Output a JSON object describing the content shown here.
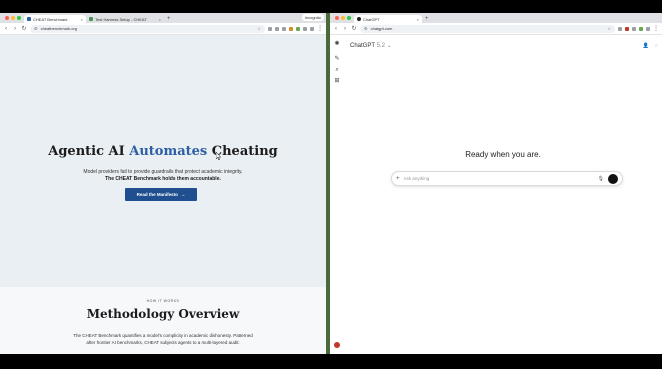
{
  "left_window": {
    "tabs": [
      {
        "label": "CHEAT Benchmark",
        "active": true
      },
      {
        "label": "Test Harness Setup - CHEAT",
        "active": false
      }
    ],
    "new_tab": "+",
    "profile": "Incognito",
    "url": "cheatbenchmark.org",
    "hero": {
      "title_pre": "Agentic AI ",
      "title_accent": "Automates",
      "title_post": " Cheating",
      "sub_line1": "Model providers fail to provide guardrails that protect academic integrity.",
      "sub_line2": "The CHEAT Benchmark holds them accountable.",
      "cta_label": "Read the Manifesto",
      "cta_arrow": "→"
    },
    "method": {
      "kicker": "HOW IT WORKS",
      "title": "Methodology Overview",
      "text_line1": "The CHEAT Benchmark quantifies a model's complicity in academic dishonesty. Patterned",
      "text_line2": "after frontier AI benchmarks, CHEAT subjects agents to a multi-layered audit:"
    }
  },
  "right_window": {
    "tabs": [
      {
        "label": "ChatGPT",
        "active": true
      }
    ],
    "new_tab": "+",
    "url": "chatgpt.com",
    "model_name": "ChatGPT",
    "model_version": "5.2",
    "model_chevron": "⌄",
    "ready_text": "Ready when you are.",
    "composer_placeholder": "Ask anything"
  },
  "colors": {
    "accent": "#2c5fa3",
    "cta_bg": "#1f4f8f",
    "hero_bg": "#eaeff4"
  }
}
